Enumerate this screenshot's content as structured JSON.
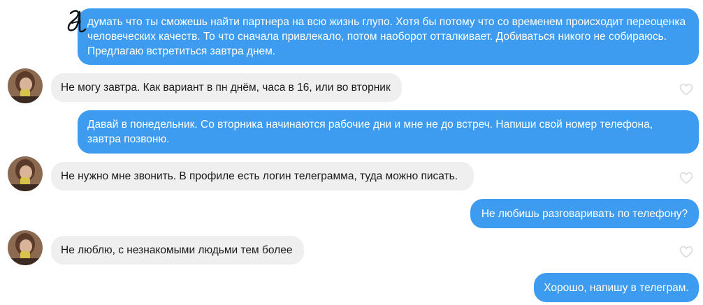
{
  "chat": {
    "messages": [
      {
        "id": 1,
        "direction": "outgoing",
        "text": "думать что ты сможешь найти партнера на всю жизнь глупо. Хотя бы потому что со временем происходит переоценка человеческих качеств. То что сначала привлекало, потом наоборот отталкивает. Добиваться никого не собираюсь. Предлагаю встретиться завтра днем."
      },
      {
        "id": 2,
        "direction": "incoming",
        "text": "Не могу завтра. Как вариант в пн днём, часа в 16, или во вторник"
      },
      {
        "id": 3,
        "direction": "outgoing",
        "text": "Давай в понедельник. Со вторника начинаются рабочие дни и мне не до встреч. Напиши свой номер телефона, завтра позвоню."
      },
      {
        "id": 4,
        "direction": "incoming",
        "text": "Не нужно мне звонить. В профиле есть логин телеграмма, туда можно писать."
      },
      {
        "id": 5,
        "direction": "outgoing",
        "text": "Не любишь разговаривать по телефону?"
      },
      {
        "id": 6,
        "direction": "incoming",
        "text": "Не люблю, с незнакомыми людьми тем более"
      },
      {
        "id": 7,
        "direction": "outgoing",
        "text": "Хорошо, напишу в телеграм."
      }
    ]
  },
  "colors": {
    "outgoing_bubble": "#3d9cf0",
    "incoming_bubble": "#efefef",
    "heart_outline": "#d8d8d8"
  },
  "icons": {
    "like": "heart-outline-icon",
    "avatar": "contact-avatar"
  }
}
